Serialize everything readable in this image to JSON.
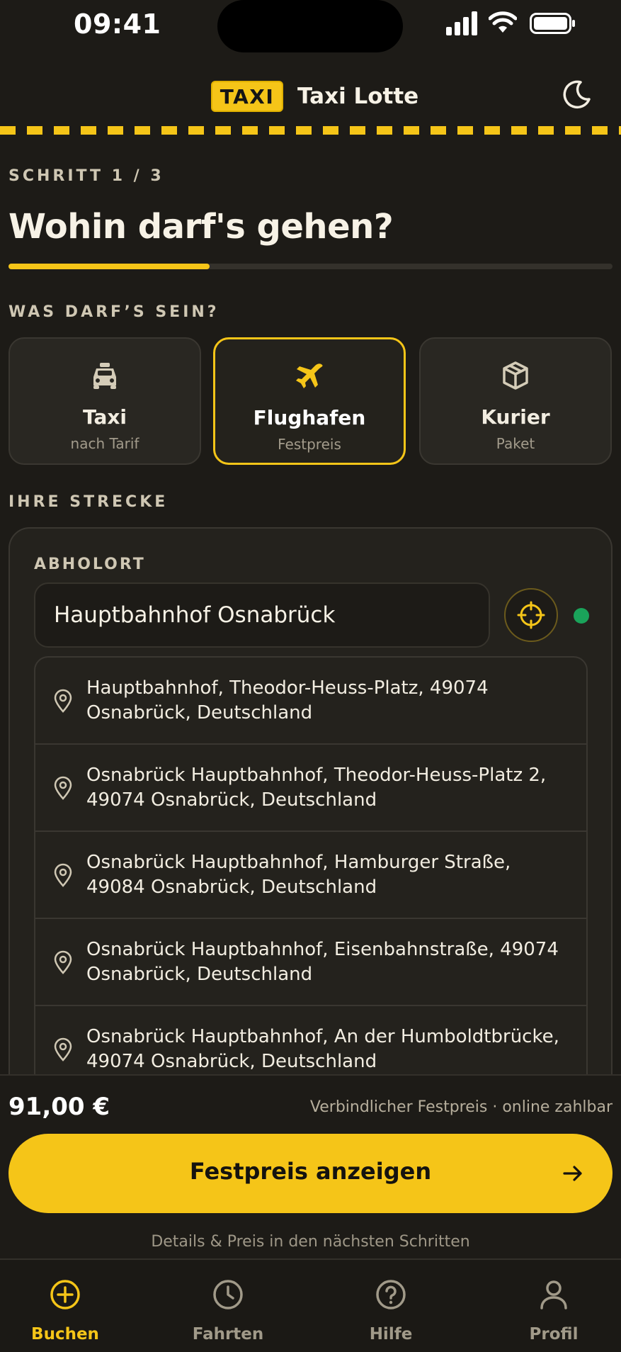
{
  "status_bar": {
    "time": "09:41"
  },
  "header": {
    "logo_badge": "TAXI",
    "app_title": "Taxi Lotte",
    "theme_icon": "moon-icon"
  },
  "step": {
    "label": "SCHRITT 1 / 3",
    "title": "Wohin darf's gehen?",
    "progress": 0.333
  },
  "services": {
    "section_label": "WAS DARF’S SEIN?",
    "items": [
      {
        "name": "Taxi",
        "sub": "nach Tarif",
        "icon": "car-icon",
        "selected": false
      },
      {
        "name": "Flughafen",
        "sub": "Festpreis",
        "icon": "plane-icon",
        "selected": true
      },
      {
        "name": "Kurier",
        "sub": "Paket",
        "icon": "package-icon",
        "selected": false
      }
    ]
  },
  "route": {
    "section_label": "IHRE STRECKE",
    "pickup_label": "ABHOLORT",
    "pickup_value": "Hauptbahnhof Osnabrück",
    "suggestions": [
      "Hauptbahnhof, Theodor-Heuss-Platz, 49074 Osnabrück, Deutschland",
      "Osnabrück Hauptbahnhof, Theodor-Heuss-Platz 2, 49074 Osnabrück, Deutschland",
      "Osnabrück Hauptbahnhof, Hamburger Straße, 49084 Osnabrück, Deutschland",
      "Osnabrück Hauptbahnhof, Eisenbahnstraße, 49074 Osnabrück, Deutschland",
      "Osnabrück Hauptbahnhof, An der Humboldtbrücke, 49074 Osnabrück, Deutschland"
    ]
  },
  "footer": {
    "price": "91,00 €",
    "price_note": "Verbindlicher Festpreis · online zahlbar",
    "cta_label": "Festpreis anzeigen",
    "hint": "Details & Preis in den nächsten Schritten"
  },
  "tabs": [
    {
      "label": "Buchen",
      "icon": "plus-circle-icon",
      "active": true
    },
    {
      "label": "Fahrten",
      "icon": "clock-icon",
      "active": false
    },
    {
      "label": "Hilfe",
      "icon": "help-circle-icon",
      "active": false
    },
    {
      "label": "Profil",
      "icon": "user-icon",
      "active": false
    }
  ],
  "colors": {
    "accent": "#f5c518",
    "background": "#1d1b17",
    "online_dot": "#1aa35a"
  }
}
